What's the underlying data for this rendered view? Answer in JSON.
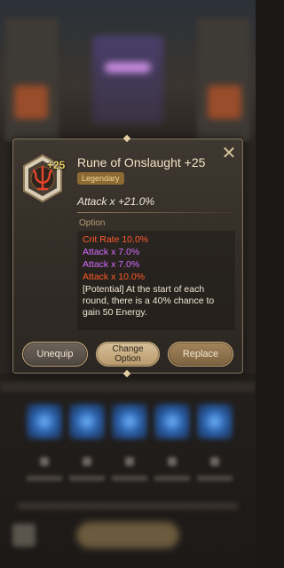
{
  "popup": {
    "title_name": "Rune of Onslaught",
    "title_level": "+25",
    "level_badge": "+25",
    "rarity": "Legendary",
    "main_stat": "Attack x +21.0%",
    "option_label": "Option",
    "options": [
      {
        "text": "Crit Rate 10.0%",
        "color": "#ff5a2b"
      },
      {
        "text": "Attack x 7.0%",
        "color": "#d56bff"
      },
      {
        "text": "Attack x 7.0%",
        "color": "#d56bff"
      },
      {
        "text": "Attack x 10.0%",
        "color": "#ff5a2b"
      }
    ],
    "potential": "[Potential] At the start of each round, there is a 40% chance to gain 50 Energy.",
    "close_icon": "close-icon",
    "rune_icon": "rune-trident-icon"
  },
  "buttons": {
    "unequip": "Unequip",
    "change_line1": "Change",
    "change_line2": "Option",
    "replace": "Replace"
  },
  "colors": {
    "accent_gold": "#c9ac7c",
    "rarity_bg": "#8c6a34"
  }
}
